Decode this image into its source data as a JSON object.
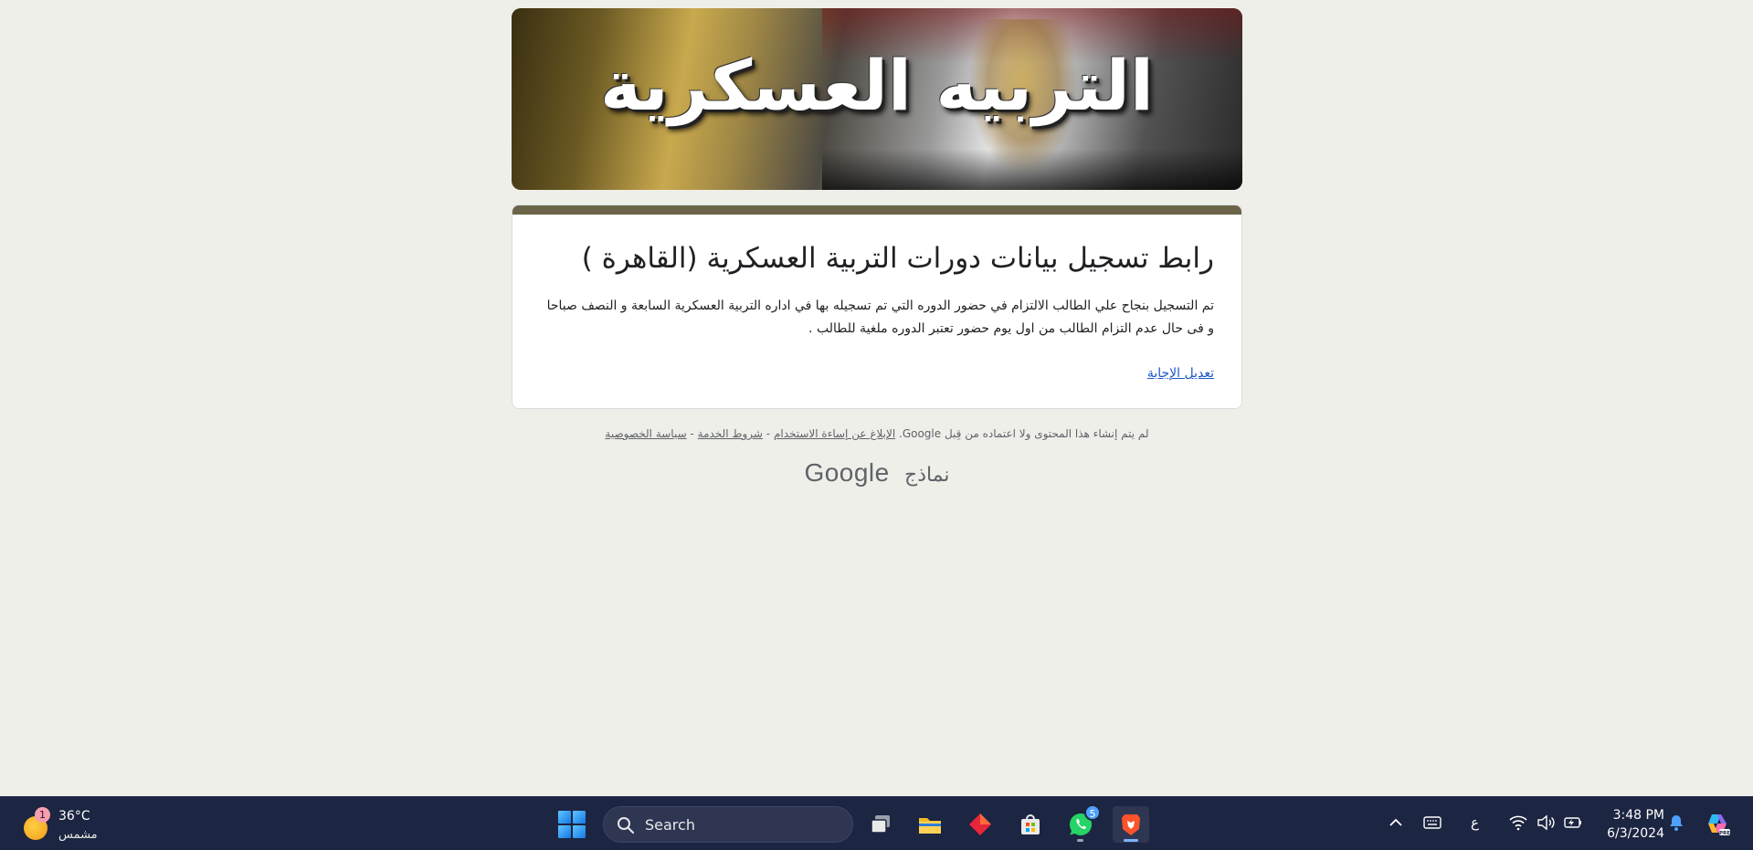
{
  "banner": {
    "title": "التربيه العسكرية"
  },
  "form": {
    "title": "رابط تسجيل بيانات دورات التربية العسكرية    (القاهرة )",
    "confirmation": "تم التسجيل بنجاح علي الطالب الالتزام في حضور الدوره التي تم تسجيله بها في اداره التربية العسكرية  السابعة و النصف صباحا و فى حال عدم التزام الطالب من اول يوم حضور تعتبر الدوره ملغية للطالب .",
    "edit_link": "تعديل الإجابة"
  },
  "footer": {
    "disclaimer_text": "لم يتم إنشاء هذا المحتوى ولا اعتماده من قِبل Google.",
    "report_abuse": "الإبلاغ عن إساءة الاستخدام",
    "separator": "-",
    "terms": "شروط الخدمة",
    "privacy": "سياسة الخصوصية",
    "brand_google": "Google",
    "brand_forms": "نماذج"
  },
  "taskbar": {
    "weather": {
      "temp": "36°C",
      "condition": "مشمس",
      "badge": "1"
    },
    "search_label": "Search",
    "whatsapp_badge": "5",
    "language": "ع",
    "time": "3:48 PM",
    "date": "6/3/2024",
    "colors": {
      "background": "#1c2541",
      "accent": "#7fb3ff"
    }
  }
}
